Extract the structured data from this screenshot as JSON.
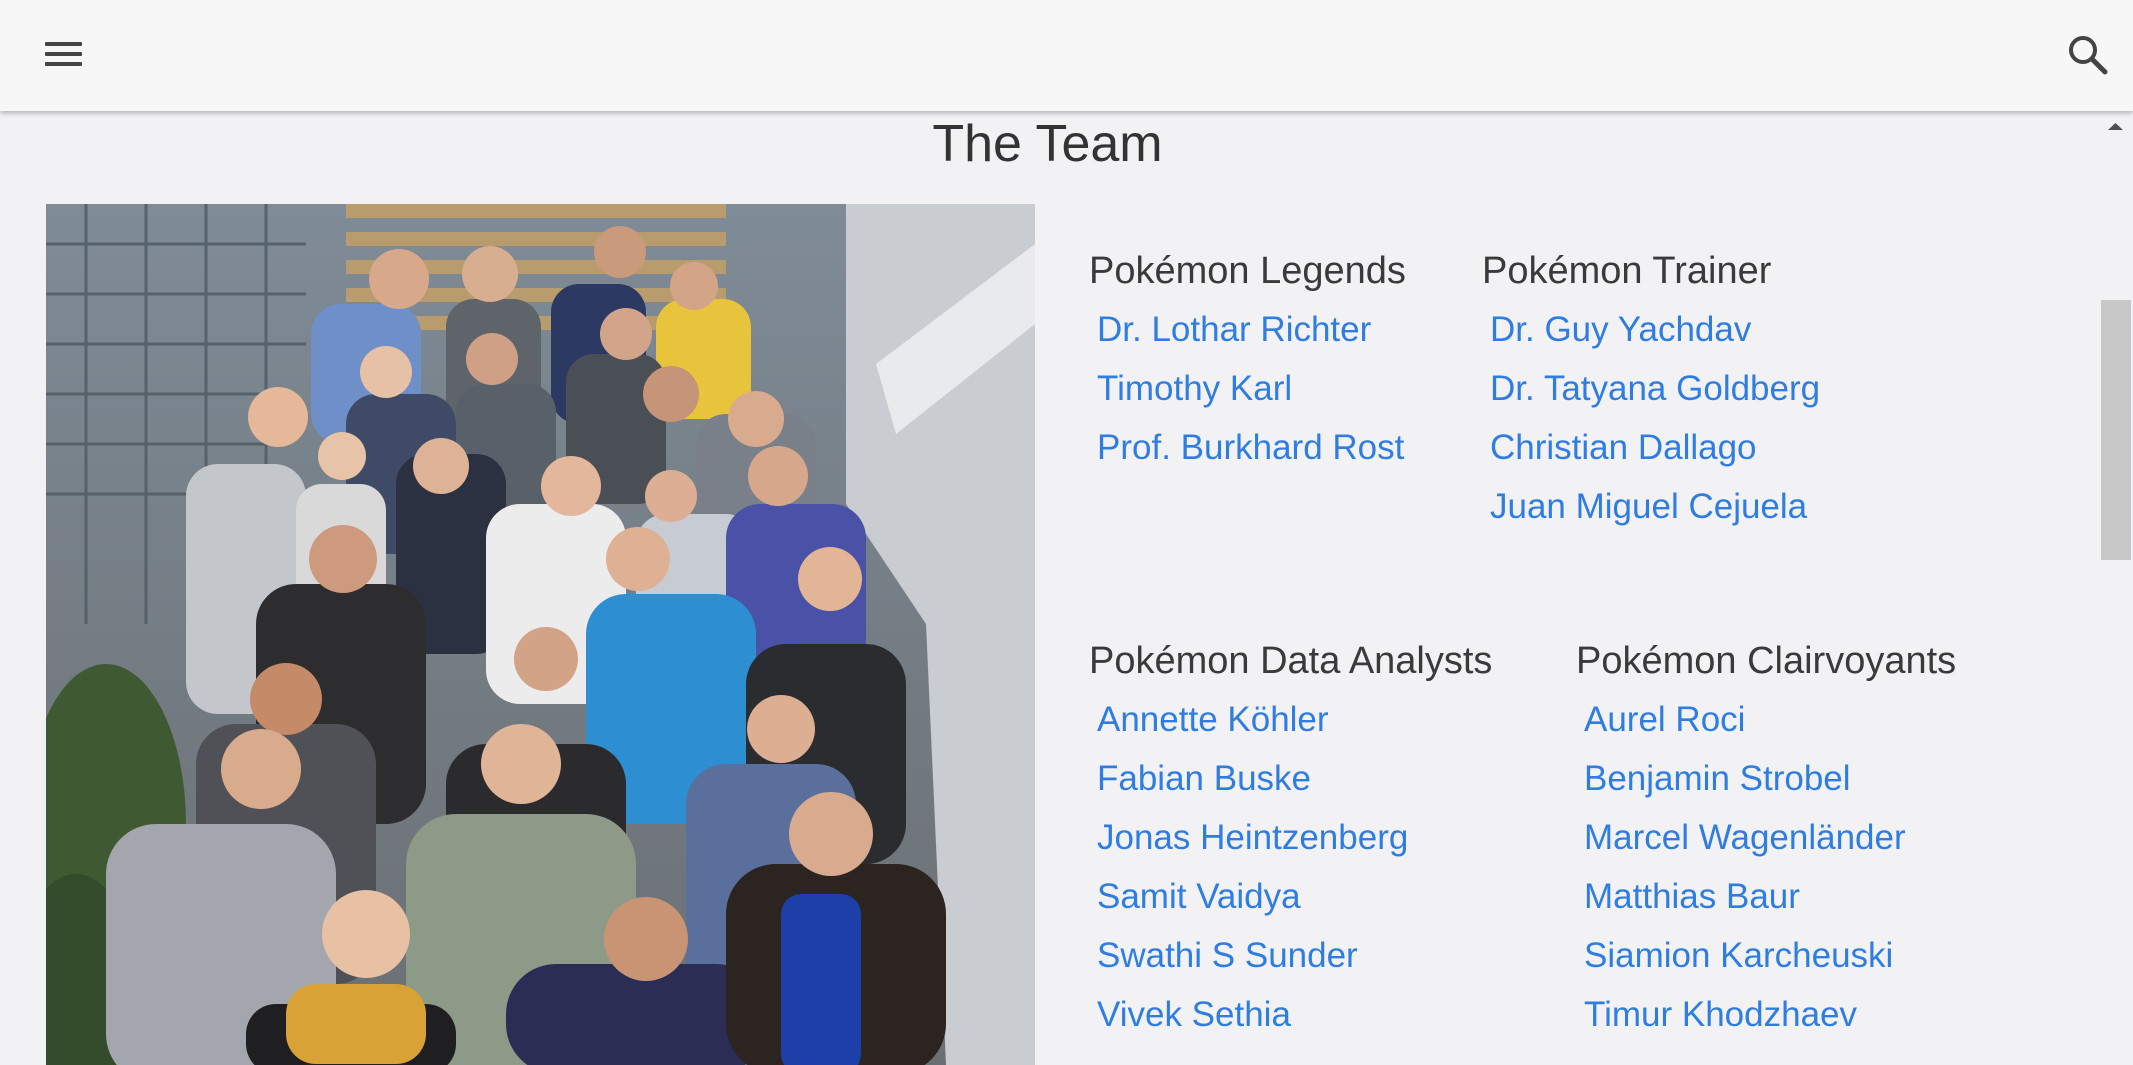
{
  "header": {
    "menu_icon": "hamburger-menu-icon",
    "search_icon": "search-icon"
  },
  "page": {
    "title": "The Team"
  },
  "photo": {
    "alt": "Group photo of the team standing on a staircase"
  },
  "groups": {
    "legends": {
      "heading": "Pokémon Legends",
      "members": [
        "Dr. Lothar Richter",
        "Timothy Karl",
        "Prof. Burkhard Rost"
      ]
    },
    "trainer": {
      "heading": "Pokémon Trainer",
      "members": [
        "Dr. Guy Yachdav",
        "Dr. Tatyana Goldberg",
        "Christian Dallago",
        "Juan Miguel Cejuela"
      ]
    },
    "analysts": {
      "heading": "Pokémon Data Analysts",
      "members": [
        "Annette Köhler",
        "Fabian Buske",
        "Jonas Heintzenberg",
        "Samit Vaidya",
        "Swathi S Sunder",
        "Vivek Sethia"
      ]
    },
    "clairvoyants": {
      "heading": "Pokémon Clairvoyants",
      "members": [
        "Aurel Roci",
        "Benjamin Strobel",
        "Marcel Wagenländer",
        "Matthias Baur",
        "Siamion Karcheuski",
        "Timur Khodzhaev"
      ]
    }
  },
  "colors": {
    "link": "#2f7de1",
    "heading": "#3a3a3a",
    "background": "#f2f2f4",
    "topbar": "#f7f7f7"
  }
}
